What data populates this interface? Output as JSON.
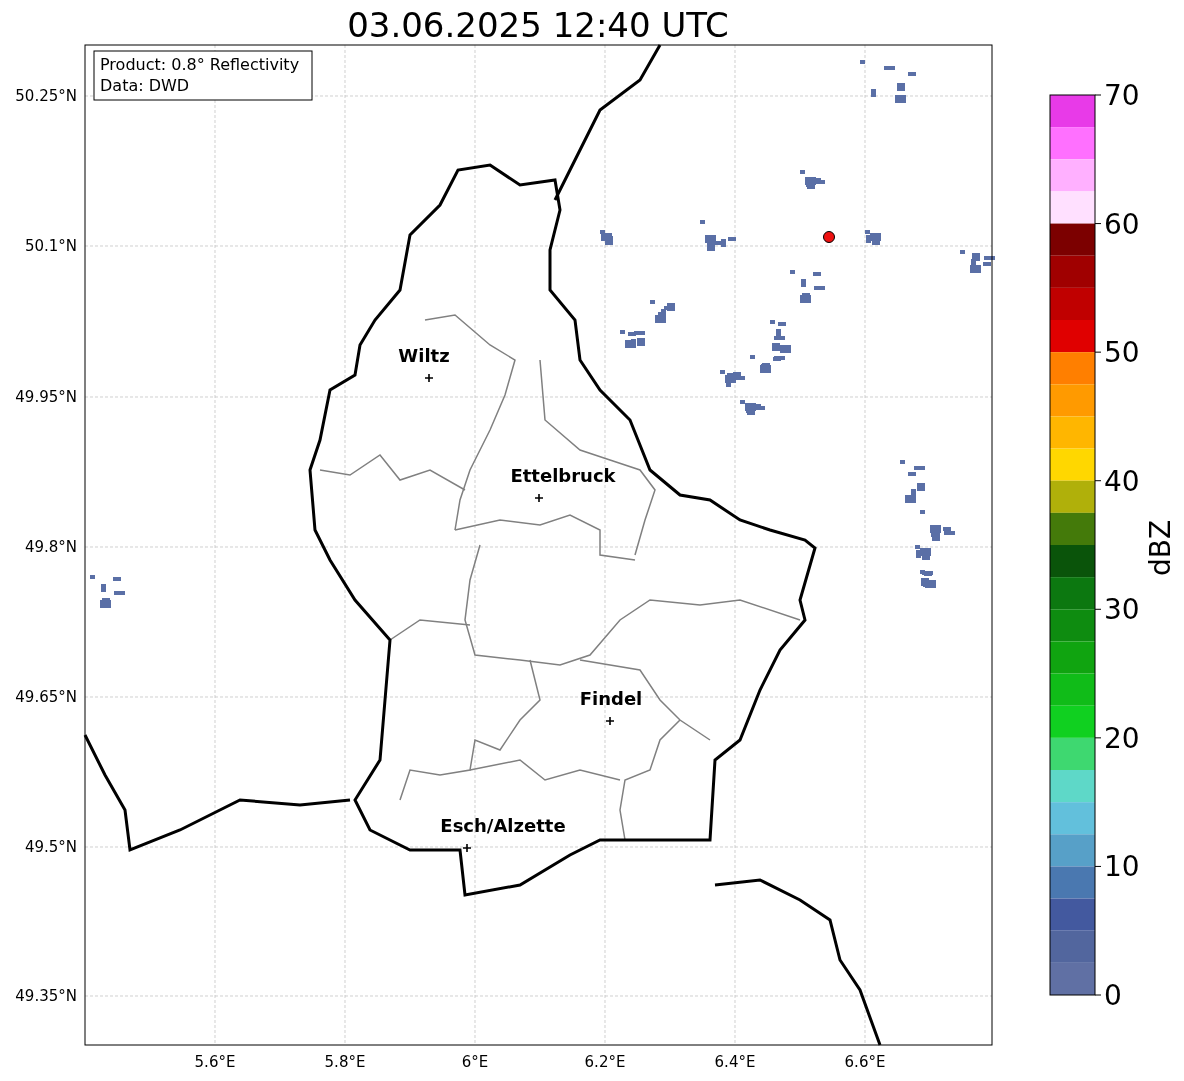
{
  "title": "03.06.2025 12:40 UTC",
  "info_box": {
    "lines": [
      "Product: 0.8° Reflectivity",
      "Data: DWD"
    ]
  },
  "map": {
    "lat_ticks": [
      "50.25°N",
      "50.1°N",
      "49.95°N",
      "49.8°N",
      "49.65°N",
      "49.5°N",
      "49.35°N"
    ],
    "lon_ticks": [
      "5.6°E",
      "5.8°E",
      "6°E",
      "6.2°E",
      "6.4°E",
      "6.6°E"
    ],
    "cities": [
      {
        "name": "Wiltz"
      },
      {
        "name": "Ettelbruck"
      },
      {
        "name": "Findel"
      },
      {
        "name": "Esch/Alzette"
      }
    ]
  },
  "colorbar": {
    "label": "dBZ",
    "ticks": [
      "70",
      "60",
      "50",
      "40",
      "30",
      "20",
      "10",
      "0"
    ],
    "bins": [
      {
        "color": "#e83ae8"
      },
      {
        "color": "#ff70ff"
      },
      {
        "color": "#ffb0ff"
      },
      {
        "color": "#ffe0ff"
      },
      {
        "color": "#7c0000"
      },
      {
        "color": "#a00000"
      },
      {
        "color": "#c00000"
      },
      {
        "color": "#e00000"
      },
      {
        "color": "#ff7f00"
      },
      {
        "color": "#ff9a00"
      },
      {
        "color": "#ffb600"
      },
      {
        "color": "#ffd700"
      },
      {
        "color": "#b0b00a"
      },
      {
        "color": "#447a0a"
      },
      {
        "color": "#0a540a"
      },
      {
        "color": "#0c7810"
      },
      {
        "color": "#0e8c10"
      },
      {
        "color": "#10a410"
      },
      {
        "color": "#10bc18"
      },
      {
        "color": "#10d020"
      },
      {
        "color": "#3ed870"
      },
      {
        "color": "#5ed8c8"
      },
      {
        "color": "#62c0dc"
      },
      {
        "color": "#57a0c8"
      },
      {
        "color": "#4a78b0"
      },
      {
        "color": "#43599f"
      },
      {
        "color": "#52669e"
      },
      {
        "color": "#6070a4"
      }
    ]
  }
}
